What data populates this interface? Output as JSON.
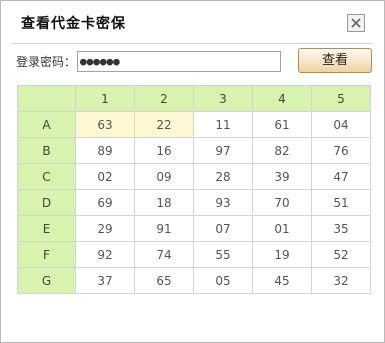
{
  "dialog": {
    "title": "查看代金卡密保",
    "close_symbol": "×"
  },
  "login": {
    "label": "登录密码：",
    "password_value": "●●●●●●",
    "view_button_label": "查看"
  },
  "grid": {
    "columns": [
      "1",
      "2",
      "3",
      "4",
      "5"
    ],
    "rows": [
      {
        "label": "A",
        "cells": [
          "63",
          "22",
          "11",
          "61",
          "04"
        ]
      },
      {
        "label": "B",
        "cells": [
          "89",
          "16",
          "97",
          "82",
          "76"
        ]
      },
      {
        "label": "C",
        "cells": [
          "02",
          "09",
          "28",
          "39",
          "47"
        ]
      },
      {
        "label": "D",
        "cells": [
          "69",
          "18",
          "93",
          "70",
          "51"
        ]
      },
      {
        "label": "E",
        "cells": [
          "29",
          "91",
          "07",
          "01",
          "35"
        ]
      },
      {
        "label": "F",
        "cells": [
          "92",
          "74",
          "55",
          "19",
          "52"
        ]
      },
      {
        "label": "G",
        "cells": [
          "37",
          "65",
          "05",
          "45",
          "32"
        ]
      }
    ],
    "highlighted_cells": [
      "A1",
      "A2"
    ]
  },
  "colors": {
    "header_green": "#d8f3ae",
    "highlight_yellow": "#fff8d2",
    "button_border": "#b58b4e"
  }
}
